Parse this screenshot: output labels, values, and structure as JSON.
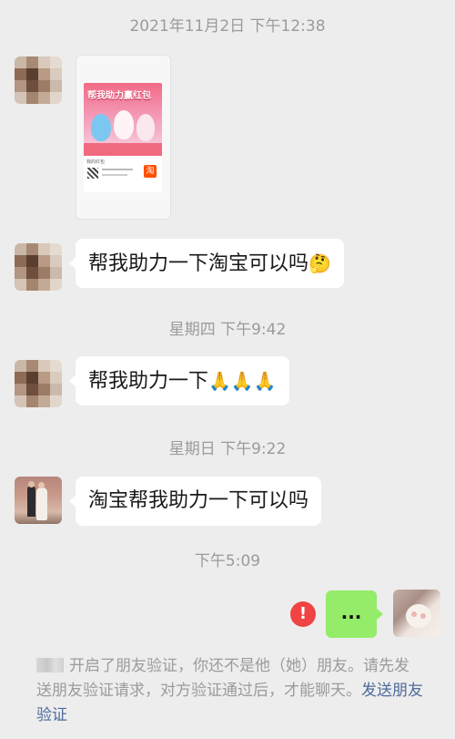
{
  "timestamps": {
    "t1": "2021年11月2日 下午12:38",
    "t2": "星期四 下午9:42",
    "t3": "星期日 下午9:22",
    "t4": "下午5:09"
  },
  "card": {
    "title": "帮我助力赢红包",
    "footer_label": "我的红包",
    "app_glyph": "淘"
  },
  "messages": {
    "m1": "帮我助力一下淘宝可以吗",
    "m1_emoji": "🤔",
    "m2": "帮我助力一下",
    "m2_emoji": "🙏🙏🙏",
    "m3": "淘宝帮我助力一下可以吗",
    "sent": "...",
    "sent_error": "!"
  },
  "notice": {
    "text": "开启了朋友验证，你还不是他（她）朋友。请先发送朋友验证请求，对方验证通过后，才能聊天。",
    "link": "发送朋友验证"
  },
  "colors": {
    "background": "#ededed",
    "bubble_incoming": "#ffffff",
    "bubble_outgoing": "#95ec69",
    "error": "#f04343",
    "link": "#4e6b9b"
  }
}
